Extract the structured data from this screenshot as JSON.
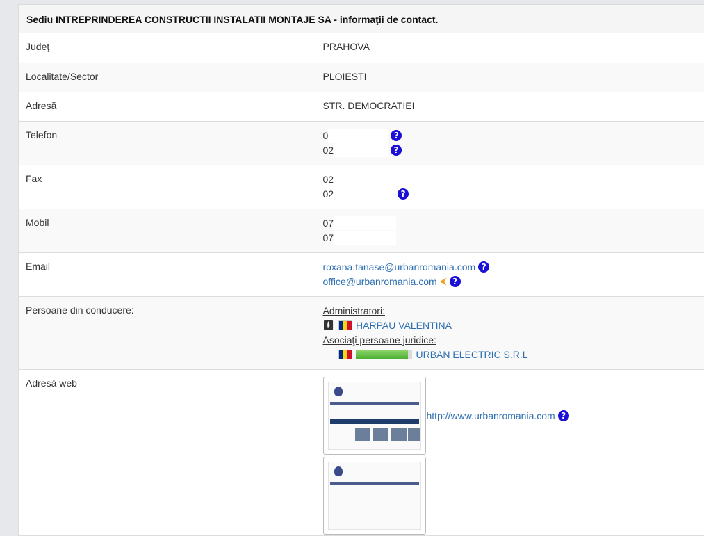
{
  "header": {
    "title": "Sediu INTREPRINDEREA CONSTRUCTII INSTALATII MONTAJE SA - informaţii de contact."
  },
  "rows": {
    "judet": {
      "label": "Judeţ",
      "value": "PRAHOVA"
    },
    "localitate": {
      "label": "Localitate/Sector",
      "value": "PLOIESTI"
    },
    "adresa": {
      "label": "Adresă",
      "value": "STR. DEMOCRATIEI"
    },
    "telefon": {
      "label": "Telefon",
      "values": [
        "0",
        "02"
      ]
    },
    "fax": {
      "label": "Fax",
      "values": [
        "02",
        "02"
      ]
    },
    "mobil": {
      "label": "Mobil",
      "values": [
        "07",
        "07"
      ]
    },
    "email": {
      "label": "Email",
      "values": [
        "roxana.tanase@urbanromania.com",
        "office@urbanromania.com"
      ]
    },
    "persoane": {
      "label": "Persoane din conducere:",
      "administratori_label": "Administratori:",
      "administrator": "HARPAU VALENTINA",
      "asociati_label": "Asociaţi persoane juridice:",
      "asociat": "URBAN ELECTRIC S.R.L"
    },
    "web": {
      "label": "Adresă web",
      "url": "http://www.urbanromania.com"
    }
  },
  "icons": {
    "help": "?",
    "share": "<",
    "person": "person-icon",
    "flag": "romania-flag-icon"
  },
  "colors": {
    "link": "#2d6fb1",
    "help": "#1a10d6",
    "share": "#f0a020"
  }
}
